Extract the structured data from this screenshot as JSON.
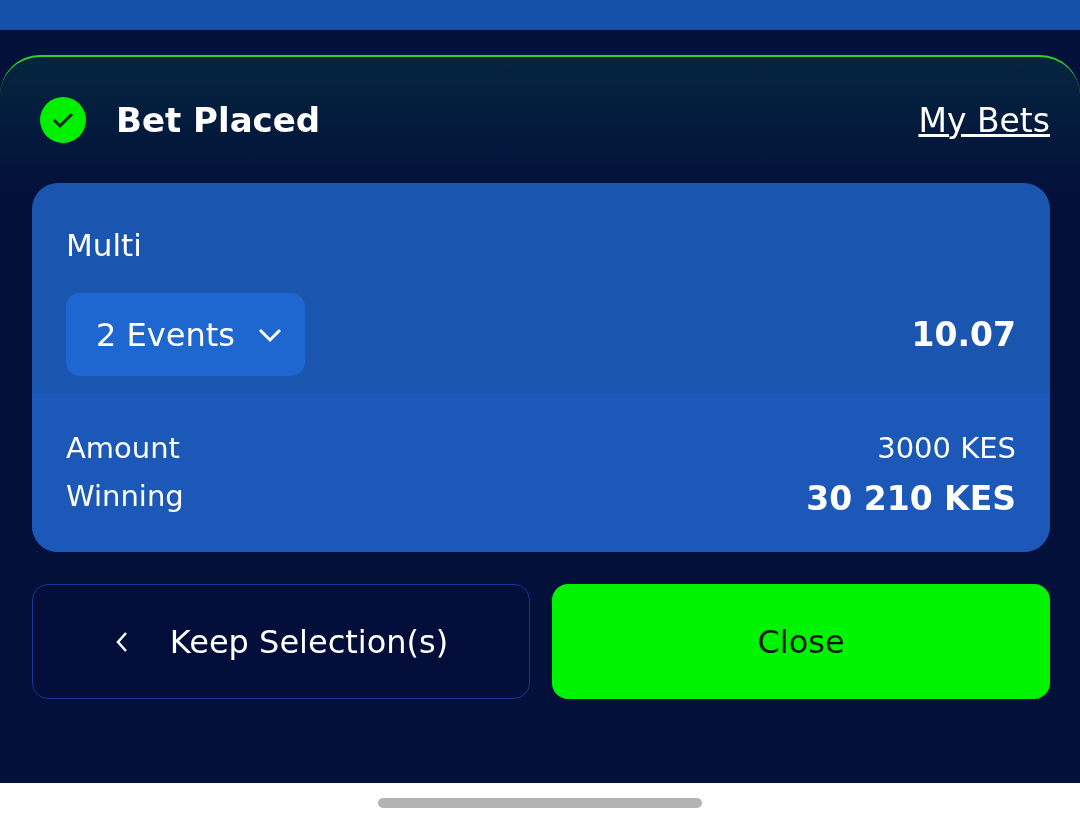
{
  "header": {
    "title": "Bet Placed",
    "link": "My Bets"
  },
  "bet": {
    "type": "Multi",
    "events_button": "2 Events",
    "odds": "10.07",
    "rows": [
      {
        "label": "Amount",
        "value": "3000 KES",
        "kind": "normal"
      },
      {
        "label": "Winning",
        "value": "30 210 KES",
        "kind": "total"
      }
    ]
  },
  "buttons": [
    {
      "label": "Keep Selection(s)",
      "kind": "secondary"
    },
    {
      "label": "Close",
      "kind": "primary"
    }
  ]
}
